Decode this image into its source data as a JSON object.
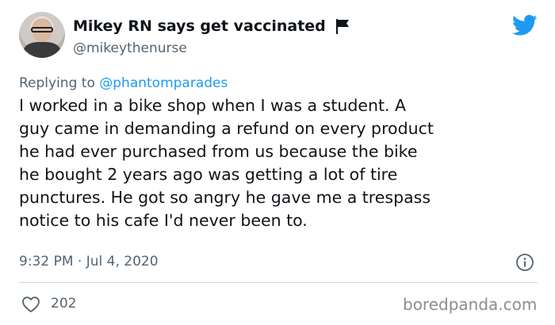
{
  "author": {
    "display_name": "Mikey RN says get vaccinated",
    "handle": "@mikeythenurse",
    "flag_icon": "black-flag-icon"
  },
  "platform_icon": "twitter-bird-icon",
  "reply": {
    "prefix": "Replying to ",
    "mention": "@phantomparades"
  },
  "tweet": {
    "text": "I worked in a bike shop when I was a student. A\nguy came in demanding a refund on every product\nhe had ever purchased from us because the bike\nhe bought 2 years ago was getting a lot of tire\npunctures. He got so angry he gave me a trespass\nnotice to his cafe I'd never been to.",
    "timestamp": "9:32 PM · Jul 4, 2020"
  },
  "engagement": {
    "likes": "202"
  },
  "watermark": "boredpanda.com",
  "colors": {
    "text": "#0f1419",
    "secondary": "#536471",
    "accent": "#1d9bf0",
    "divider": "#cfd9de"
  }
}
